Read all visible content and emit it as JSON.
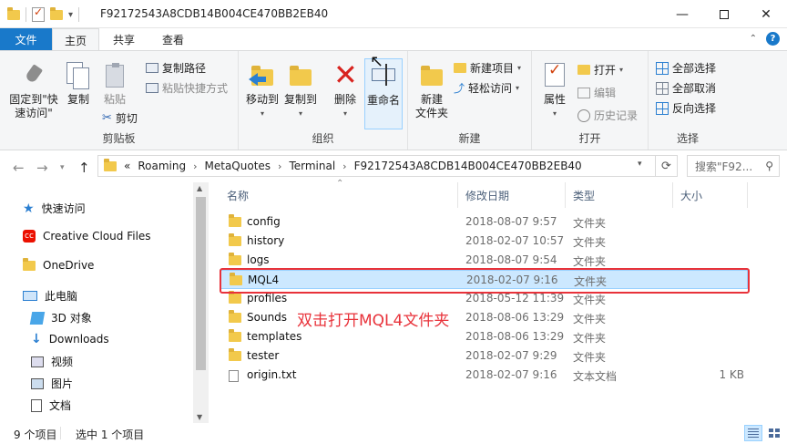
{
  "window": {
    "title": "F92172543A8CDB14B004CE470BB2EB40"
  },
  "tabs": [
    {
      "label": "文件"
    },
    {
      "label": "主页"
    },
    {
      "label": "共享"
    },
    {
      "label": "查看"
    }
  ],
  "ribbon": {
    "clipboard": {
      "group_label": "剪贴板",
      "pin_line1": "固定到\"快",
      "pin_line2": "速访问\"",
      "copy": "复制",
      "paste": "粘贴",
      "copy_path": "复制路径",
      "paste_shortcut": "粘贴快捷方式",
      "cut": "剪切"
    },
    "organize": {
      "group_label": "组织",
      "move_to": "移动到",
      "copy_to": "复制到",
      "delete": "删除",
      "rename": "重命名"
    },
    "new": {
      "group_label": "新建",
      "new_folder_line1": "新建",
      "new_folder_line2": "文件夹",
      "new_item": "新建项目",
      "easy_access": "轻松访问"
    },
    "open": {
      "group_label": "打开",
      "properties": "属性",
      "open": "打开",
      "edit": "编辑",
      "history": "历史记录"
    },
    "select": {
      "group_label": "选择",
      "select_all": "全部选择",
      "select_none": "全部取消",
      "invert": "反向选择"
    }
  },
  "address": {
    "crumbs": [
      "Roaming",
      "MetaQuotes",
      "Terminal",
      "F92172543A8CDB14B004CE470BB2EB40"
    ],
    "overflow": "«",
    "search_placeholder": "搜索\"F92..."
  },
  "nav": {
    "items": [
      {
        "label": "快速访问",
        "icon": "star-icon"
      },
      {
        "label": "Creative Cloud Files",
        "icon": "creative-cloud-icon"
      },
      {
        "label": "OneDrive",
        "icon": "folder-icon"
      },
      {
        "label": "此电脑",
        "icon": "computer-icon"
      },
      {
        "label": "3D 对象",
        "icon": "3d-objects-icon"
      },
      {
        "label": "Downloads",
        "icon": "download-icon"
      },
      {
        "label": "视频",
        "icon": "video-icon"
      },
      {
        "label": "图片",
        "icon": "picture-icon"
      },
      {
        "label": "文档",
        "icon": "document-icon"
      }
    ]
  },
  "columns": {
    "name": "名称",
    "date": "修改日期",
    "type": "类型",
    "size": "大小"
  },
  "files": [
    {
      "name": "config",
      "date": "2018-08-07 9:57",
      "type": "文件夹",
      "size": "",
      "kind": "folder"
    },
    {
      "name": "history",
      "date": "2018-02-07 10:57",
      "type": "文件夹",
      "size": "",
      "kind": "folder"
    },
    {
      "name": "logs",
      "date": "2018-08-07 9:54",
      "type": "文件夹",
      "size": "",
      "kind": "folder"
    },
    {
      "name": "MQL4",
      "date": "2018-02-07 9:16",
      "type": "文件夹",
      "size": "",
      "kind": "folder",
      "selected": true
    },
    {
      "name": "profiles",
      "date": "2018-05-12 11:39",
      "type": "文件夹",
      "size": "",
      "kind": "folder"
    },
    {
      "name": "Sounds",
      "date": "2018-08-06 13:29",
      "type": "文件夹",
      "size": "",
      "kind": "folder"
    },
    {
      "name": "templates",
      "date": "2018-08-06 13:29",
      "type": "文件夹",
      "size": "",
      "kind": "folder"
    },
    {
      "name": "tester",
      "date": "2018-02-07 9:29",
      "type": "文件夹",
      "size": "",
      "kind": "folder"
    },
    {
      "name": "origin.txt",
      "date": "2018-02-07 9:16",
      "type": "文本文档",
      "size": "1 KB",
      "kind": "file"
    }
  ],
  "annotation": "双击打开MQL4文件夹",
  "status": {
    "item_count": "9 个项目",
    "selected_count": "选中 1 个项目"
  },
  "colors": {
    "accent": "#1979ca",
    "selection": "#cce8ff",
    "annotation": "#e8323a"
  }
}
